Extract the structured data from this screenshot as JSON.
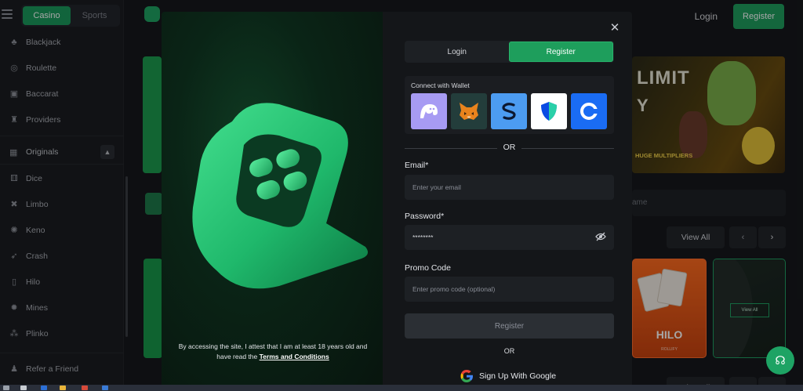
{
  "top": {
    "mode_tabs": [
      "Casino",
      "Sports"
    ],
    "login": "Login",
    "register": "Register"
  },
  "sidebar": {
    "items_top": [
      {
        "label": "Blackjack",
        "icon": "blackjack-icon"
      },
      {
        "label": "Roulette",
        "icon": "roulette-icon"
      },
      {
        "label": "Baccarat",
        "icon": "baccarat-icon"
      },
      {
        "label": "Providers",
        "icon": "providers-icon"
      }
    ],
    "section": "Originals",
    "items_originals": [
      {
        "label": "Dice",
        "icon": "dice-icon"
      },
      {
        "label": "Limbo",
        "icon": "limbo-icon"
      },
      {
        "label": "Keno",
        "icon": "keno-icon"
      },
      {
        "label": "Crash",
        "icon": "rocket-icon"
      },
      {
        "label": "Hilo",
        "icon": "hilo-icon"
      },
      {
        "label": "Mines",
        "icon": "mines-icon"
      },
      {
        "label": "Plinko",
        "icon": "plinko-icon"
      }
    ],
    "refer": "Refer a Friend"
  },
  "background": {
    "banner_line1": "LIMIT",
    "banner_line2": "Y",
    "banner_tag": "HUGE MULTIPLIERS",
    "search_placeholder": "ame",
    "view_all": "View All",
    "hilo_label": "HILO",
    "hilo_brand": "ROLLIFY",
    "card_view_all": "View All"
  },
  "modal": {
    "tabs": [
      "Login",
      "Register"
    ],
    "active_tab": "Register",
    "wallet_title": "Connect with Wallet",
    "wallets": [
      "phantom-icon",
      "metamask-icon",
      "wallet-s-icon",
      "trust-wallet-icon",
      "coinbase-icon"
    ],
    "or": "OR",
    "email_label": "Email*",
    "email_placeholder": "Enter your email",
    "password_label": "Password*",
    "password_value": "********",
    "promo_label": "Promo Code",
    "promo_placeholder": "Enter promo code (optional)",
    "submit": "Register",
    "or_small": "OR",
    "google": "Sign Up With Google",
    "disclaimer_prefix": "By accessing the site, I attest that I am at least 18 years old and have read the ",
    "disclaimer_link": "Terms and Conditions"
  },
  "colors": {
    "accent": "#1e9e5c",
    "modal_bg": "#141619",
    "input_bg": "#1d2024"
  }
}
